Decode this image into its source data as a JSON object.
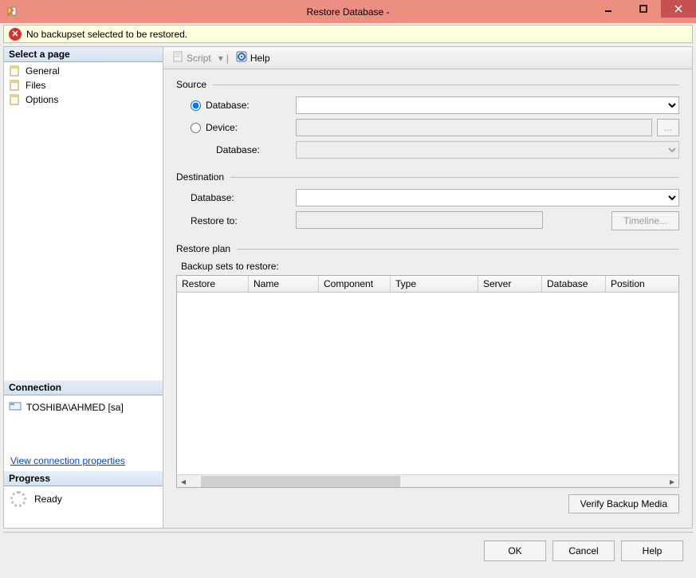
{
  "title": "Restore Database -",
  "warning": "No backupset selected to be restored.",
  "nav": {
    "header": "Select a page",
    "items": [
      "General",
      "Files",
      "Options"
    ]
  },
  "connection": {
    "header": "Connection",
    "server": "TOSHIBA\\AHMED [sa]",
    "link": "View connection properties"
  },
  "progress": {
    "header": "Progress",
    "status": "Ready"
  },
  "toolbar": {
    "script": "Script",
    "help": "Help"
  },
  "source": {
    "header": "Source",
    "database_label": "Database:",
    "device_label": "Device:",
    "device_db_label": "Database:",
    "browse": "..."
  },
  "destination": {
    "header": "Destination",
    "database_label": "Database:",
    "restore_to_label": "Restore to:",
    "timeline": "Timeline..."
  },
  "plan": {
    "header": "Restore plan",
    "subheader": "Backup sets to restore:",
    "columns": [
      "Restore",
      "Name",
      "Component",
      "Type",
      "Server",
      "Database",
      "Position"
    ]
  },
  "verify": "Verify Backup Media",
  "buttons": {
    "ok": "OK",
    "cancel": "Cancel",
    "help": "Help"
  }
}
